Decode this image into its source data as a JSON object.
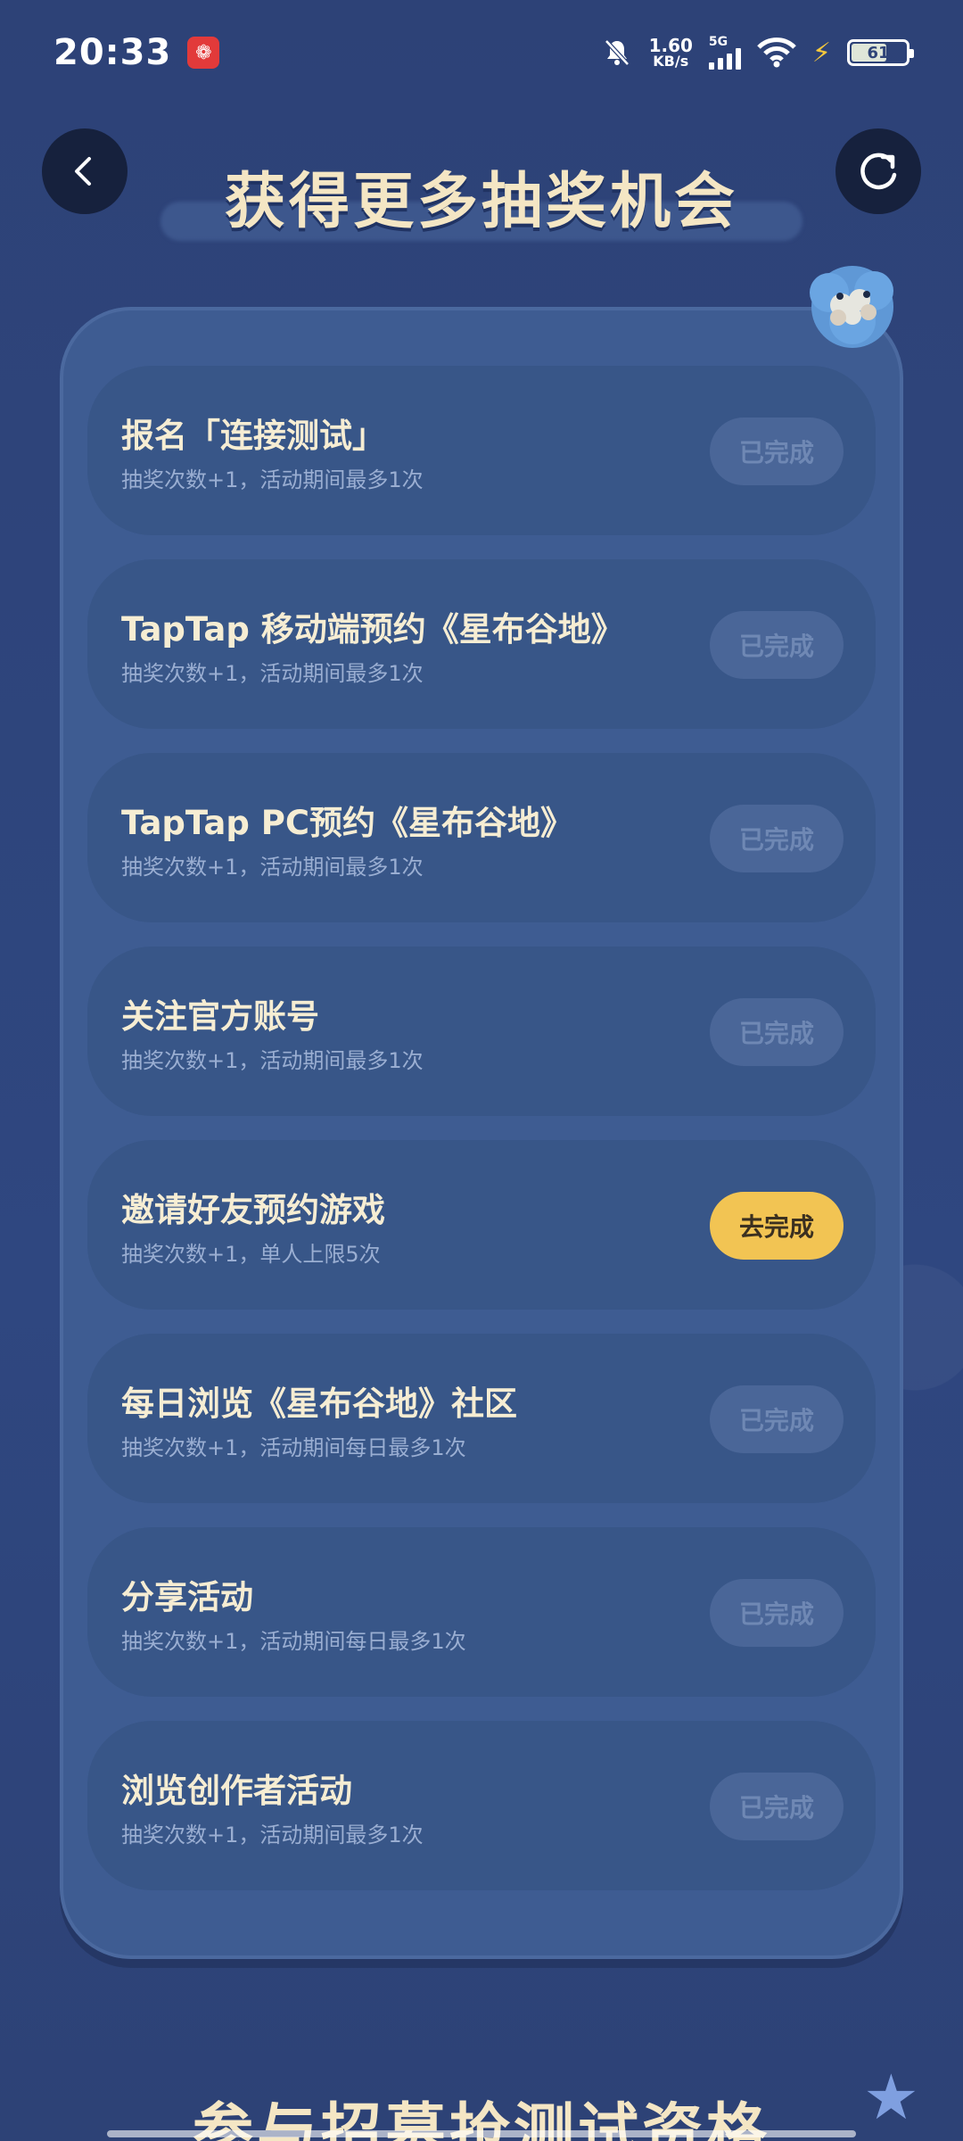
{
  "status_bar": {
    "time": "20:33",
    "net_speed_value": "1.60",
    "net_speed_unit": "KB/s",
    "network": "5G",
    "battery": "61",
    "icons": [
      "mute-bell-icon",
      "signal-icon",
      "wifi-icon",
      "charging-icon",
      "battery-icon"
    ]
  },
  "header": {
    "title": "获得更多抽奖机会"
  },
  "tasks": [
    {
      "title": "报名「连接测试」",
      "desc": "抽奖次数+1，活动期间最多1次",
      "button": "已完成",
      "active": false
    },
    {
      "title": "TapTap 移动端预约《星布谷地》",
      "desc": "抽奖次数+1，活动期间最多1次",
      "button": "已完成",
      "active": false
    },
    {
      "title": "TapTap PC预约《星布谷地》",
      "desc": "抽奖次数+1，活动期间最多1次",
      "button": "已完成",
      "active": false
    },
    {
      "title": "关注官方账号",
      "desc": "抽奖次数+1，活动期间最多1次",
      "button": "已完成",
      "active": false
    },
    {
      "title": "邀请好友预约游戏",
      "desc": "抽奖次数+1，单人上限5次",
      "button": "去完成",
      "active": true
    },
    {
      "title": "每日浏览《星布谷地》社区",
      "desc": "抽奖次数+1，活动期间每日最多1次",
      "button": "已完成",
      "active": false
    },
    {
      "title": "分享活动",
      "desc": "抽奖次数+1，活动期间每日最多1次",
      "button": "已完成",
      "active": false
    },
    {
      "title": "浏览创作者活动",
      "desc": "抽奖次数+1，活动期间最多1次",
      "button": "已完成",
      "active": false
    }
  ],
  "section2": {
    "title": "参与招募抢测试资格"
  },
  "colors": {
    "background": "#2f4478",
    "panel": "#3e5c92",
    "card": "#385688",
    "accent_button": "#f2c453",
    "title_text": "#f4e6c4"
  }
}
